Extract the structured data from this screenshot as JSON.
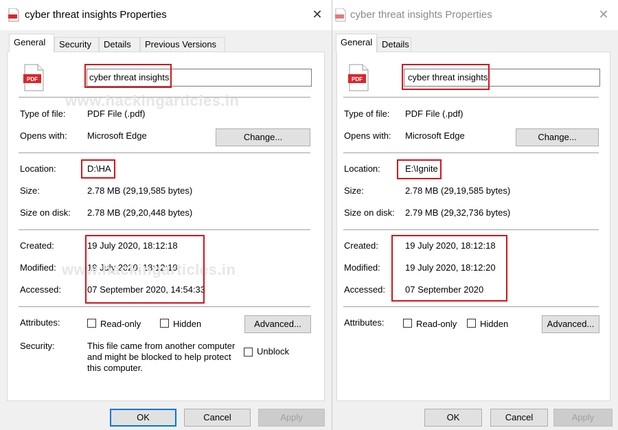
{
  "watermark": "www.hackingarticles.in",
  "left": {
    "title": "cyber threat insights Properties",
    "tabs": [
      "General",
      "Security",
      "Details",
      "Previous Versions"
    ],
    "file_icon_text": "PDF",
    "filename": "cyber threat insights",
    "type_label": "Type of file:",
    "type_value": "PDF File (.pdf)",
    "opens_label": "Opens with:",
    "opens_value": "Microsoft Edge",
    "change_label": "Change...",
    "location_label": "Location:",
    "location_value": "D:\\HA",
    "size_label": "Size:",
    "size_value": "2.78 MB (29,19,585 bytes)",
    "disk_label": "Size on disk:",
    "disk_value": "2.78 MB (29,20,448 bytes)",
    "created_label": "Created:",
    "created_value": "19 July 2020, 18:12:18",
    "modified_label": "Modified:",
    "modified_value": "19 July 2020, 18:12:19",
    "accessed_label": "Accessed:",
    "accessed_value": "07 September 2020, 14:54:33",
    "attributes_label": "Attributes:",
    "readonly_label": "Read-only",
    "hidden_label": "Hidden",
    "advanced_label": "Advanced...",
    "security_label": "Security:",
    "security_line1": "This file came from another computer",
    "security_line2": "and might be blocked to help protect",
    "security_line3": "this computer.",
    "unblock_label": "Unblock",
    "ok_label": "OK",
    "cancel_label": "Cancel",
    "apply_label": "Apply"
  },
  "right": {
    "title": "cyber threat insights Properties",
    "tabs": [
      "General",
      "Details"
    ],
    "file_icon_text": "PDF",
    "filename": "cyber threat insights",
    "type_label": "Type of file:",
    "type_value": "PDF File (.pdf)",
    "opens_label": "Opens with:",
    "opens_value": "Microsoft Edge",
    "change_label": "Change...",
    "location_label": "Location:",
    "location_value": "E:\\Ignite",
    "size_label": "Size:",
    "size_value": "2.78 MB (29,19,585 bytes)",
    "disk_label": "Size on disk:",
    "disk_value": "2.79 MB (29,32,736 bytes)",
    "created_label": "Created:",
    "created_value": "19 July 2020, 18:12:18",
    "modified_label": "Modified:",
    "modified_value": "19 July 2020, 18:12:20",
    "accessed_label": "Accessed:",
    "accessed_value": "07 September 2020",
    "attributes_label": "Attributes:",
    "readonly_label": "Read-only",
    "hidden_label": "Hidden",
    "advanced_label": "Advanced...",
    "ok_label": "OK",
    "cancel_label": "Cancel",
    "apply_label": "Apply"
  },
  "colors": {
    "highlight": "#d0161b",
    "pdf_red": "#d9272e",
    "focus_blue": "#0078d7"
  },
  "icons": {
    "close": "close-icon",
    "file": "pdf-file-icon"
  }
}
